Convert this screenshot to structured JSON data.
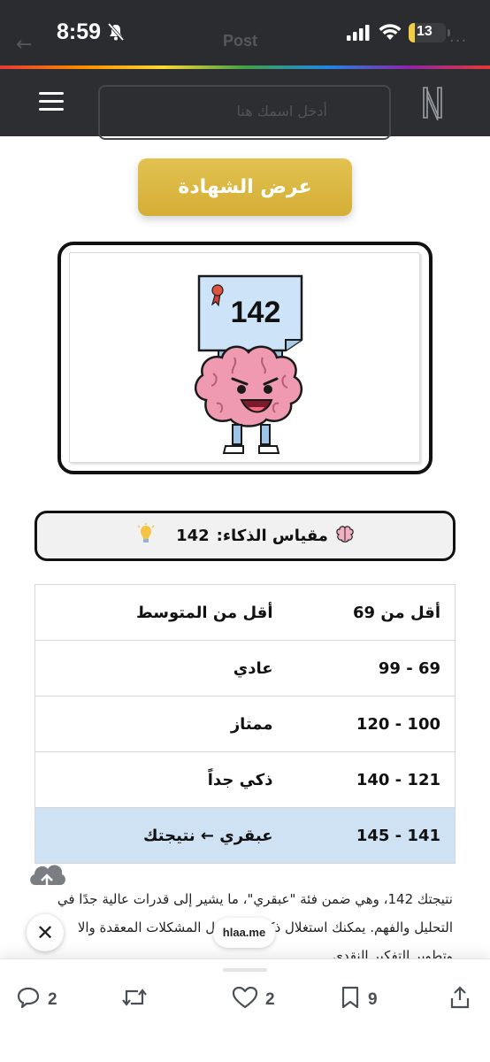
{
  "status": {
    "time": "8:59",
    "battery": "13"
  },
  "ghost_nav": {
    "title": "Post",
    "back": "←",
    "more": "···"
  },
  "header": {
    "search_placeholder": "أدخل اسمك هنا"
  },
  "certificate_button": {
    "label": "عرض الشهادة"
  },
  "certificate_image": {
    "score": "142"
  },
  "iq_summary": {
    "label": "مقياس الذكاء:",
    "value": "142"
  },
  "iq_table": {
    "rows": [
      {
        "range": "أقل من 69",
        "category": "أقل من المتوسط"
      },
      {
        "range": "69 - 99",
        "category": "عادي"
      },
      {
        "range": "100 - 120",
        "category": "ممتاز"
      },
      {
        "range": "121 - 140",
        "category": "ذكي جداً"
      },
      {
        "range": "141 - 145",
        "category": "عبقري ← نتيجتك"
      }
    ]
  },
  "paragraph": {
    "line1": "نتيجتك 142، وهي ضمن فئة \"عبقري\"، ما يشير إلى قدرات عالية جدًا في",
    "line2": "التحليل والفهم. يمكنك استغلال ذكائك في حل المشكلات المعقدة والا",
    "line3": "وتطوير التفكير النقدي"
  },
  "browser": {
    "close": "✕",
    "url": "hlaa.me"
  },
  "actions": {
    "replies": "2",
    "reposts": "",
    "likes": "2",
    "bookmarks": "9"
  },
  "colors": {
    "gold": "#d9b33c",
    "header_bg": "#2c2e31",
    "highlight_row": "#cfe2f3"
  }
}
